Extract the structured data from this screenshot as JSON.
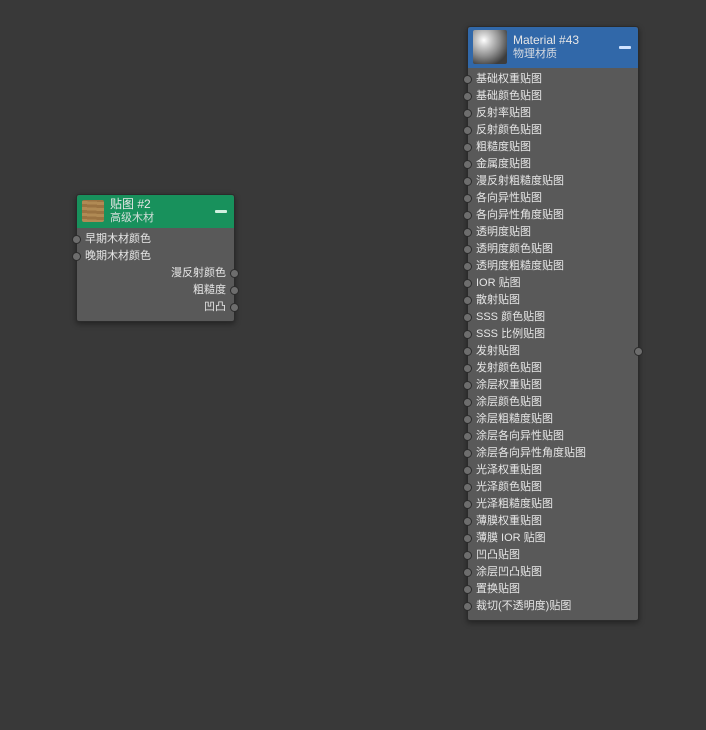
{
  "left_node": {
    "title": "贴图 #2",
    "subtitle": "高级木材",
    "inputs": [
      "早期木材颜色",
      "晚期木材颜色"
    ],
    "outputs": [
      "漫反射颜色",
      "粗糙度",
      "凹凸"
    ]
  },
  "right_node": {
    "title": "Material #43",
    "subtitle": "物理材质",
    "inputs": [
      "基础权重贴图",
      "基础颜色贴图",
      "反射率贴图",
      "反射颜色贴图",
      "粗糙度贴图",
      "金属度贴图",
      "漫反射粗糙度贴图",
      "各向异性贴图",
      "各向异性角度贴图",
      "透明度贴图",
      "透明度颜色贴图",
      "透明度粗糙度贴图",
      "IOR 贴图",
      "散射贴图",
      "SSS 颜色贴图",
      "SSS 比例贴图",
      "发射贴图",
      "发射颜色贴图",
      "涂层权重贴图",
      "涂层颜色贴图",
      "涂层粗糙度贴图",
      "涂层各向异性贴图",
      "涂层各向异性角度贴图",
      "光泽权重贴图",
      "光泽颜色贴图",
      "光泽粗糙度贴图",
      "薄膜权重贴图",
      "薄膜 IOR 贴图",
      "凹凸贴图",
      "涂层凹凸贴图",
      "置换贴图",
      "裁切(不透明度)贴图"
    ]
  }
}
